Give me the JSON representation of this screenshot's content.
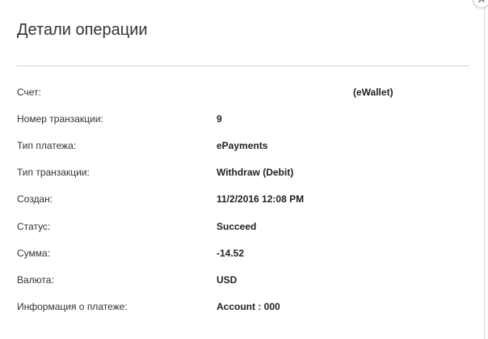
{
  "dialog": {
    "title": "Детали операции",
    "close_icon": "close-icon"
  },
  "details": [
    {
      "label": "Счет:",
      "value": "(eWallet)"
    },
    {
      "label": "Номер транзакции:",
      "value": "9"
    },
    {
      "label": "Тип платежа:",
      "value": "ePayments"
    },
    {
      "label": "Тип транзакции:",
      "value": "Withdraw (Debit)"
    },
    {
      "label": "Создан:",
      "value": "11/2/2016 12:08 PM"
    },
    {
      "label": "Статус:",
      "value": "Succeed"
    },
    {
      "label": "Сумма:",
      "value": "-14.52"
    },
    {
      "label": "Валюта:",
      "value": "USD"
    },
    {
      "label": "Информация о платеже:",
      "value": "Account : 000"
    }
  ]
}
